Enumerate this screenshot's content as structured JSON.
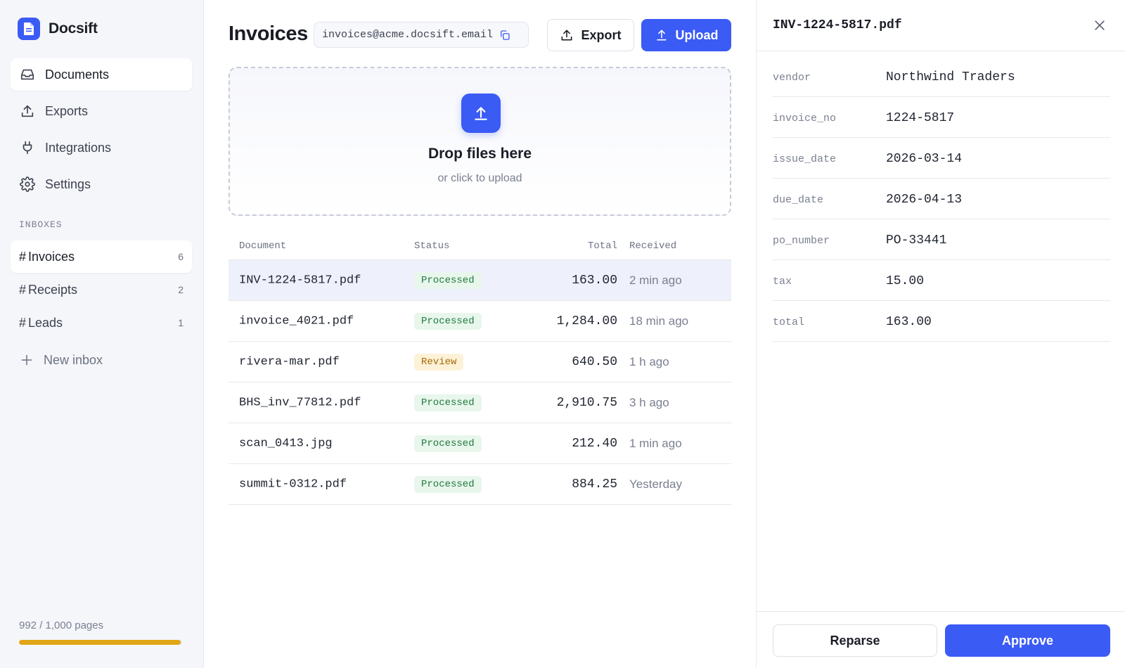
{
  "app": {
    "name": "Docsift",
    "logo_icon": "document-icon",
    "accent_color": "#3b5bf5"
  },
  "sidebar": {
    "nav": [
      {
        "label": "Documents",
        "icon": "inbox-icon",
        "active": true
      },
      {
        "label": "Exports",
        "icon": "upload-icon",
        "active": false
      },
      {
        "label": "Integrations",
        "icon": "plug-icon",
        "active": false
      },
      {
        "label": "Settings",
        "icon": "gear-icon",
        "active": false
      }
    ],
    "inboxes_label": "INBOXES",
    "inboxes": [
      {
        "hash": "#",
        "label": "Invoices",
        "count": "6",
        "active": true
      },
      {
        "hash": "#",
        "label": "Receipts",
        "count": "2",
        "active": false
      },
      {
        "hash": "#",
        "label": "Leads",
        "count": "1",
        "active": false
      }
    ],
    "new_inbox_label": "New inbox",
    "usage": {
      "text": "992 / 1,000 pages",
      "fraction": 0.992,
      "color": "#e0a615"
    }
  },
  "main": {
    "title": "Invoices",
    "inbox_email": "invoices@acme.docsift.email",
    "export_label": "Export",
    "upload_label": "Upload",
    "dropzone": {
      "title": "Drop files here",
      "subtitle": "or click to upload"
    },
    "table": {
      "columns": [
        "Document",
        "Status",
        "Total",
        "Received"
      ],
      "rows": [
        {
          "document": "INV-1224-5817.pdf",
          "status": "Processed",
          "total": "163.00",
          "received": "2 min ago",
          "selected": true
        },
        {
          "document": "invoice_4021.pdf",
          "status": "Processed",
          "total": "1,284.00",
          "received": "18 min ago"
        },
        {
          "document": "rivera-mar.pdf",
          "status": "Review",
          "total": "640.50",
          "received": "1 h ago"
        },
        {
          "document": "BHS_inv_77812.pdf",
          "status": "Processed",
          "total": "2,910.75",
          "received": "3 h ago"
        },
        {
          "document": "scan_0413.jpg",
          "status": "Processed",
          "total": "212.40",
          "received": "1 min ago"
        },
        {
          "document": "summit-0312.pdf",
          "status": "Processed",
          "total": "884.25",
          "received": "Yesterday"
        }
      ]
    }
  },
  "detail": {
    "title": "INV-1224-5817.pdf",
    "fields": [
      {
        "key": "vendor",
        "value": "Northwind Traders"
      },
      {
        "key": "invoice_no",
        "value": "1224-5817"
      },
      {
        "key": "issue_date",
        "value": "2026-03-14"
      },
      {
        "key": "due_date",
        "value": "2026-04-13"
      },
      {
        "key": "po_number",
        "value": "PO-33441"
      },
      {
        "key": "tax",
        "value": "15.00"
      },
      {
        "key": "total",
        "value": "163.00"
      }
    ],
    "reparse_label": "Reparse",
    "approve_label": "Approve"
  }
}
